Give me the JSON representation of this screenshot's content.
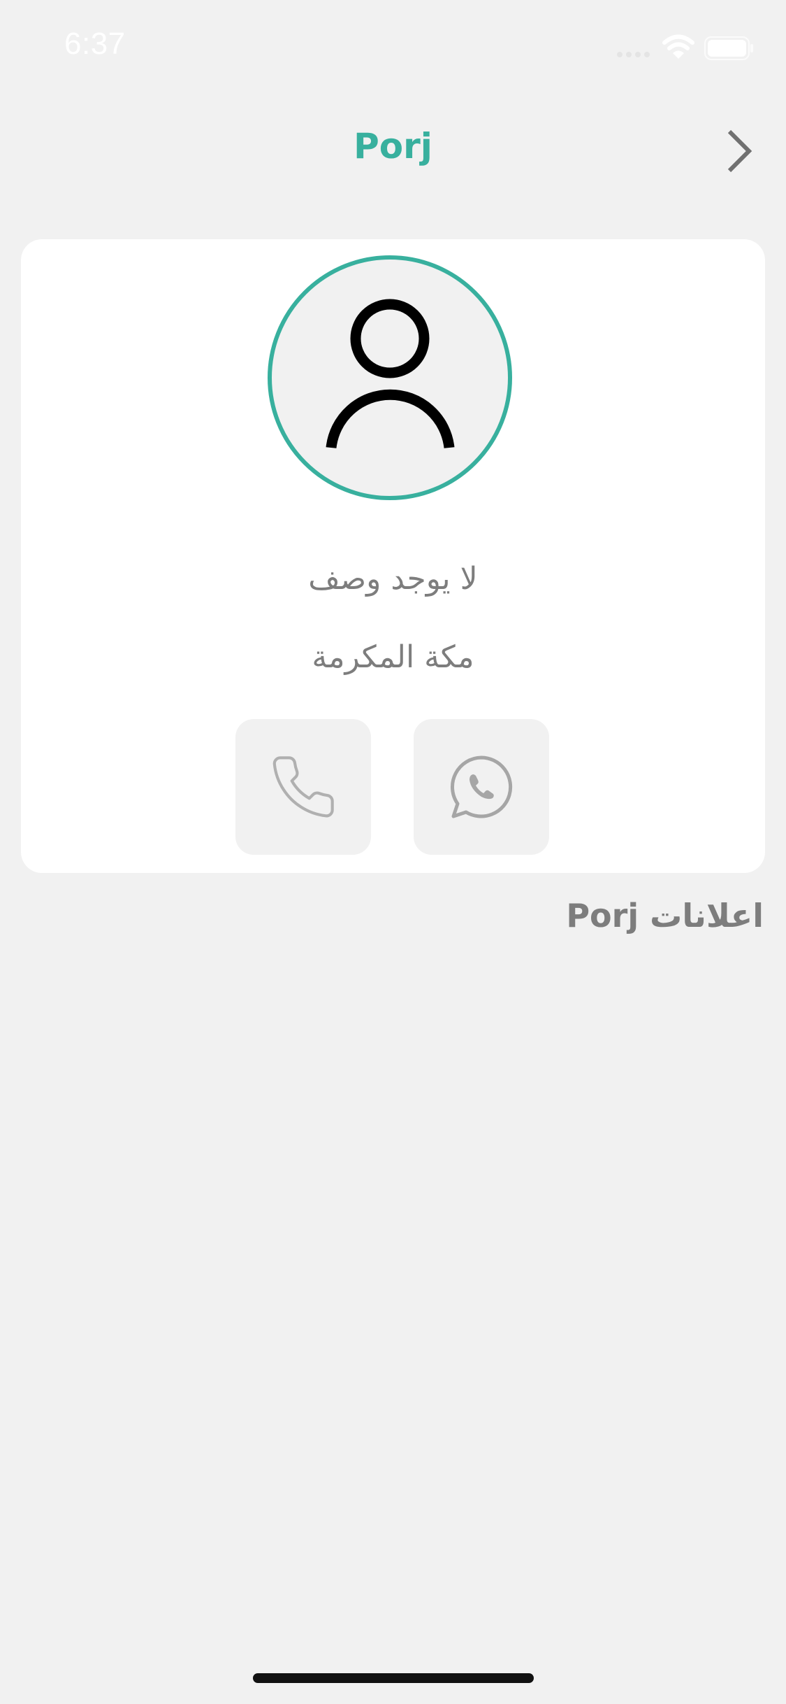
{
  "status_bar": {
    "time": "6:37",
    "icons": [
      "signal-icon",
      "wifi-icon",
      "battery-icon"
    ]
  },
  "header": {
    "title": "Porj",
    "back_icon": "chevron-right-icon"
  },
  "profile": {
    "avatar_icon": "user-icon",
    "description": "لا يوجد وصف",
    "location": "مكة المكرمة",
    "actions": [
      {
        "name": "call",
        "icon": "phone-icon"
      },
      {
        "name": "whatsapp",
        "icon": "whatsapp-icon"
      }
    ]
  },
  "ads_section": {
    "heading": "اعلانات Porj"
  },
  "colors": {
    "accent": "#38b09e",
    "background": "#f1f1f1",
    "card": "#ffffff",
    "muted_text": "#7d7d7d"
  }
}
